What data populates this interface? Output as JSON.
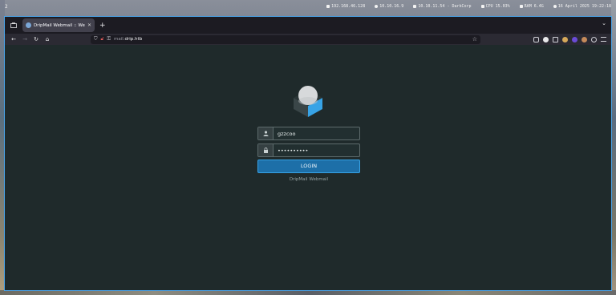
{
  "desktop": {
    "workspace": "2",
    "stats": [
      {
        "icon": "monitor-icon",
        "text": "192.168.46.128"
      },
      {
        "icon": "globe-icon",
        "text": "10.10.16.9"
      },
      {
        "icon": "target-icon",
        "text": "10.10.11.54 - DarkCorp"
      },
      {
        "icon": "cpu-icon",
        "text": "CPU 15.03%"
      },
      {
        "icon": "ram-icon",
        "text": "RAM 6.4G"
      },
      {
        "icon": "clock-icon",
        "text": "16 April 2025 19:22:18"
      }
    ]
  },
  "browser": {
    "tab": {
      "title": "DripMail Webmail :: Welcome"
    },
    "url": {
      "subdomain": "mail.",
      "domain": "drip.htb"
    }
  },
  "login": {
    "username_value": "gzzcoo",
    "password_value": "••••••••••",
    "button_label": "LOGIN",
    "footer": "DripMail Webmail"
  },
  "colors": {
    "accent": "#37a3e6",
    "button_bg": "#1d6fa8",
    "page_bg": "#1f2a2b"
  }
}
